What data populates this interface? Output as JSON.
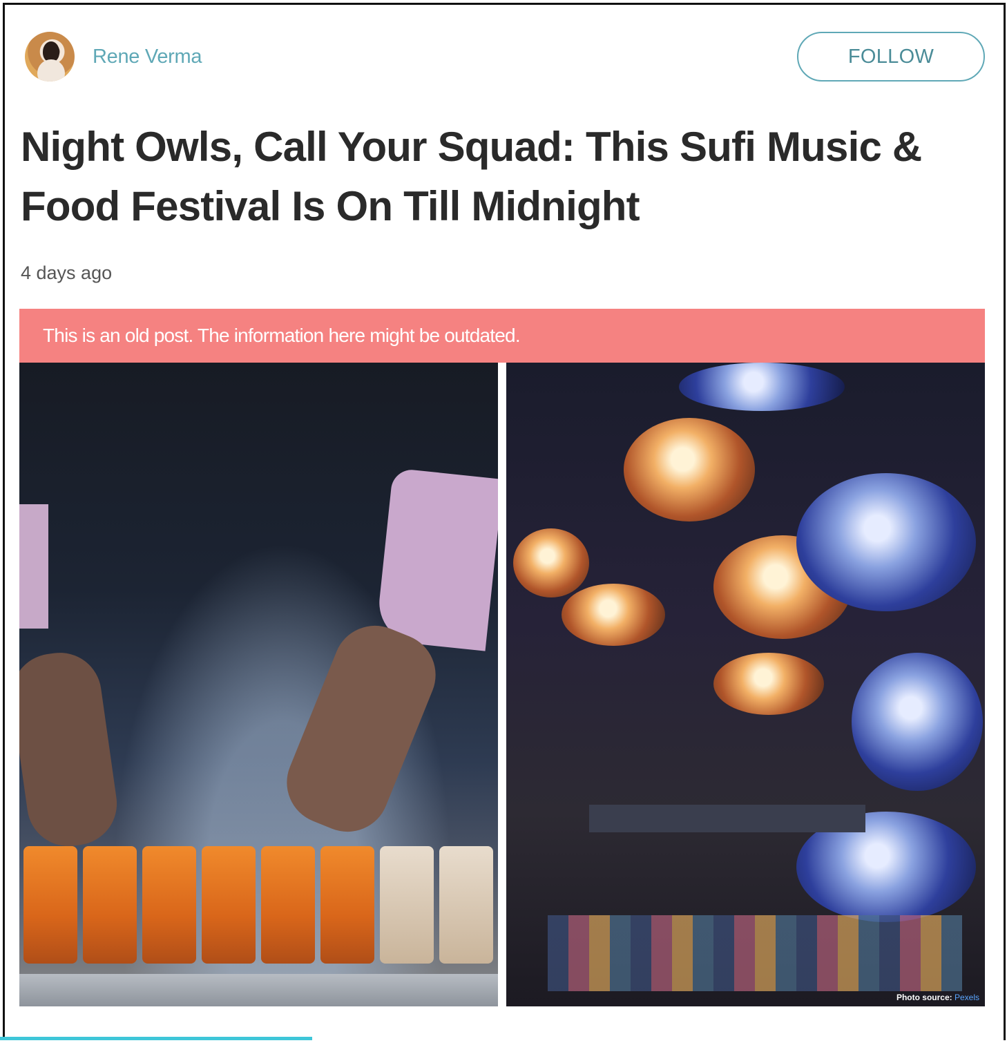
{
  "author": {
    "name": "Rene Verma",
    "avatar_icon": "author-avatar"
  },
  "follow_button": {
    "label": "FOLLOW"
  },
  "article": {
    "title": "Night Owls, Call Your Squad: This Sufi Music & Food Festival Is On Till Midnight",
    "timestamp": "4 days ago",
    "notice": "This is an old post. The information here might be outdated.",
    "photo_credit_label": "Photo source:",
    "photo_credit_source": "Pexels"
  },
  "colors": {
    "accent": "#5fa8b6",
    "notice_bg": "#f58281",
    "title": "#2a2a2a",
    "progress": "#3ec6d8"
  }
}
